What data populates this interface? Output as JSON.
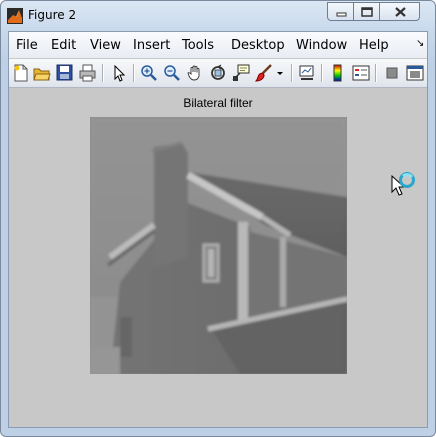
{
  "window": {
    "title": "Figure 2",
    "icons": {
      "app": "matlab-icon",
      "minimize": "minimize-icon",
      "maximize": "maximize-icon",
      "close": "close-icon"
    }
  },
  "menubar": {
    "items": [
      {
        "label": "File"
      },
      {
        "label": "Edit"
      },
      {
        "label": "View"
      },
      {
        "label": "Insert"
      },
      {
        "label": "Tools"
      },
      {
        "label": "Desktop"
      },
      {
        "label": "Window"
      },
      {
        "label": "Help"
      }
    ],
    "overflow_icon": "chevron-more-icon"
  },
  "toolbar": {
    "buttons": [
      "new-figure-icon",
      "open-file-icon",
      "save-icon",
      "print-icon",
      "edit-plot-arrow-icon",
      "zoom-in-icon",
      "zoom-out-icon",
      "pan-hand-icon",
      "rotate-3d-icon",
      "data-cursor-icon",
      "brush-icon",
      "brush-dropdown-icon",
      "link-plot-icon",
      "colorbar-icon",
      "legend-icon",
      "hide-plot-tools-icon",
      "show-plot-tools-icon"
    ]
  },
  "axes": {
    "title": "Bilateral filter",
    "image": "filtered-house-image"
  },
  "cursor": "busy-cursor-icon"
}
